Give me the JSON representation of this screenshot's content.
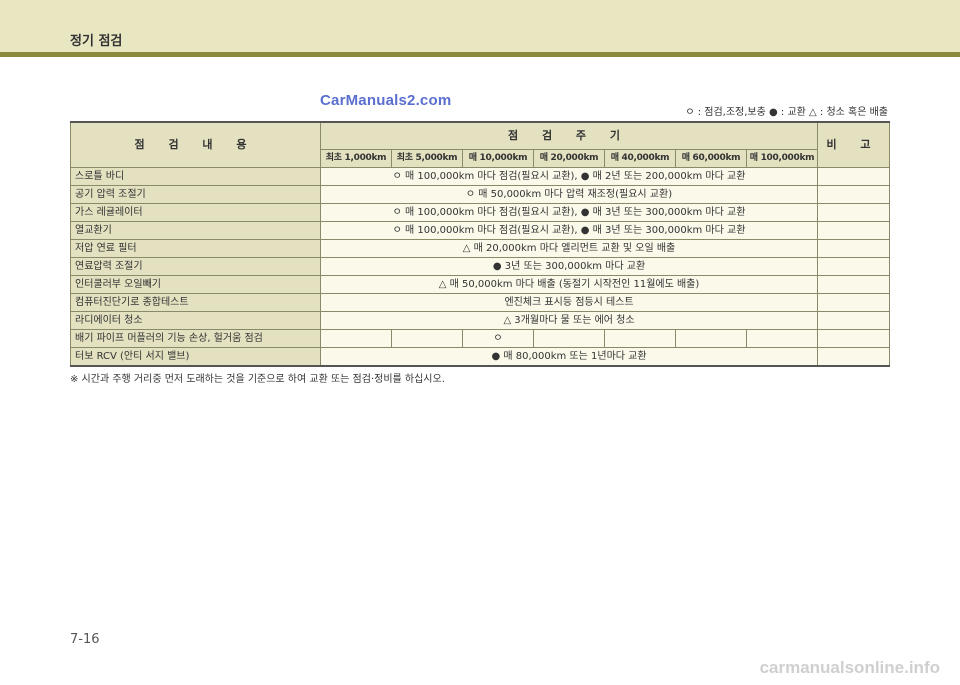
{
  "header": {
    "title": "정기 점검"
  },
  "watermark_top": "CarManuals2.com",
  "legend": "ㅇ : 점검,조정,보충  ● : 교환  △ : 청소 혹은 배출",
  "table": {
    "col_item": "점 검 내 용",
    "col_period": "점 검 주 기",
    "col_note": "비 고",
    "intervals": [
      "최초 1,000km",
      "최초 5,000km",
      "매 10,000km",
      "매 20,000km",
      "매 40,000km",
      "매 60,000km",
      "매 100,000km"
    ],
    "rows": [
      {
        "item": "스로틀 바디",
        "desc": "ㅇ 매 100,000km 마다 점검(필요시 교환), ● 매 2년 또는 200,000km 마다 교환"
      },
      {
        "item": "공기 압력 조절기",
        "desc": "ㅇ 매 50,000km 마다 압력 재조정(필요시 교환)"
      },
      {
        "item": "가스 레귤레이터",
        "desc": "ㅇ 매 100,000km 마다 점검(필요시 교환), ● 매 3년 또는 300,000km 마다 교환"
      },
      {
        "item": "열교환기",
        "desc": "ㅇ 매 100,000km 마다 점검(필요시 교환), ● 매 3년 또는 300,000km 마다 교환"
      },
      {
        "item": "저압 연료 필터",
        "desc": "△ 매 20,000km 마다 엘리먼트 교환 및 오일 배출"
      },
      {
        "item": "연료압력 조절기",
        "desc": "● 3년 또는 300,000km 마다 교환"
      },
      {
        "item": "인터쿨러부 오일빼기",
        "desc": "△ 매 50,000km 마다 배출 (동절기 시작전인 11월에도 배출)"
      },
      {
        "item": "컴퓨터진단기로 종합테스트",
        "desc": "엔진체크 표시등 점등시 테스트"
      },
      {
        "item": "라디에이터 청소",
        "desc": "△ 3개월마다 물 또는 에어 청소"
      }
    ],
    "exhaust_row": {
      "item": "배기 파이프 머플러의 기능 손상, 헐거움 점검",
      "mark": "ㅇ"
    },
    "turbo_row": {
      "item": "터보 RCV (안티 서지 밸브)",
      "desc": "● 매 80,000km 또는 1년마다 교환"
    }
  },
  "footnote": "※ 시간과 주행 거리중 먼저 도래하는 것을 기준으로 하여 교환 또는 점검·정비를 하십시오.",
  "page_number": "7-16",
  "footer_watermark": "carmanualsonline.info"
}
